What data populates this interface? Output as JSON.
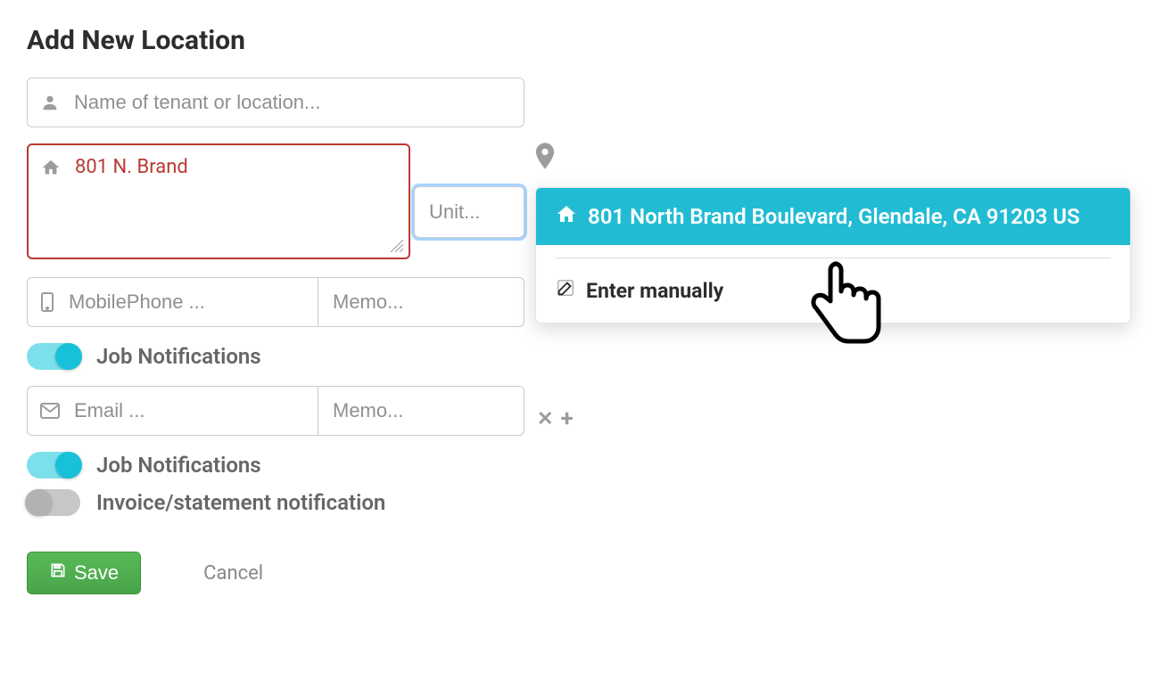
{
  "title": "Add New Location",
  "name_placeholder": "Name of tenant or location...",
  "address_value": "801 N. Brand",
  "unit_placeholder": "Unit...",
  "phone_placeholder": "MobilePhone ...",
  "phone_memo_placeholder": "Memo...",
  "toggle_phone_label": "Job Notifications",
  "email_placeholder": "Email ...",
  "email_memo_placeholder": "Memo...",
  "toggle_email_label": "Job Notifications",
  "toggle_invoice_label": "Invoice/statement notification",
  "save_label": "Save",
  "cancel_label": "Cancel",
  "suggestion_text": "801 North Brand Boulevard, Glendale, CA 91203 US",
  "manual_label": "Enter manually"
}
